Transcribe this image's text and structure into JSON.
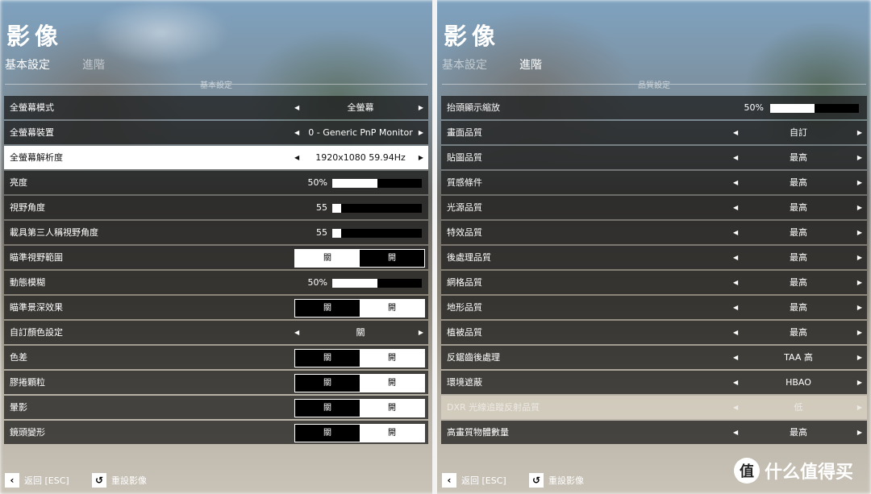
{
  "left": {
    "title": "影像",
    "tabs": [
      "基本設定",
      "進階"
    ],
    "section": "基本設定",
    "rows": [
      {
        "type": "select",
        "label": "全螢幕模式",
        "value": "全螢幕"
      },
      {
        "type": "select",
        "label": "全螢幕裝置",
        "value": "0 - Generic PnP Monitor"
      },
      {
        "type": "select",
        "label": "全螢幕解析度",
        "value": "1920x1080 59.94Hz",
        "selected": true
      },
      {
        "type": "slider",
        "label": "亮度",
        "value": "50%",
        "fraction": 0.5
      },
      {
        "type": "slider",
        "label": "視野角度",
        "value": "55",
        "fraction": 0.1
      },
      {
        "type": "slider",
        "label": "載具第三人稱視野角度",
        "value": "55",
        "fraction": 0.1
      },
      {
        "type": "toggle",
        "label": "瞄準視野範圍",
        "off": "關",
        "on": "開",
        "active": "off"
      },
      {
        "type": "slider",
        "label": "動態模糊",
        "value": "50%",
        "fraction": 0.5
      },
      {
        "type": "toggle",
        "label": "瞄準景深效果",
        "off": "關",
        "on": "開",
        "active": "on"
      },
      {
        "type": "select",
        "label": "自訂顏色設定",
        "value": "關"
      },
      {
        "type": "toggle",
        "label": "色差",
        "off": "關",
        "on": "開",
        "active": "on"
      },
      {
        "type": "toggle",
        "label": "膠捲顆粒",
        "off": "關",
        "on": "開",
        "active": "on"
      },
      {
        "type": "toggle",
        "label": "暈影",
        "off": "關",
        "on": "開",
        "active": "on"
      },
      {
        "type": "toggle",
        "label": "鏡頭變形",
        "off": "關",
        "on": "開",
        "active": "on"
      }
    ],
    "footer": {
      "back": "返回 [ESC]",
      "reset": "重設影像"
    }
  },
  "right": {
    "title": "影像",
    "tabs": [
      "基本設定",
      "進階"
    ],
    "section": "品質設定",
    "rows": [
      {
        "type": "slider",
        "label": "抬頭顯示縮放",
        "value": "50%",
        "fraction": 0.5
      },
      {
        "type": "select",
        "label": "畫面品質",
        "value": "自訂"
      },
      {
        "type": "select",
        "label": "貼圖品質",
        "value": "最高"
      },
      {
        "type": "select",
        "label": "質感條件",
        "value": "最高"
      },
      {
        "type": "select",
        "label": "光源品質",
        "value": "最高"
      },
      {
        "type": "select",
        "label": "特效品質",
        "value": "最高"
      },
      {
        "type": "select",
        "label": "後處理品質",
        "value": "最高"
      },
      {
        "type": "select",
        "label": "網格品質",
        "value": "最高"
      },
      {
        "type": "select",
        "label": "地形品質",
        "value": "最高"
      },
      {
        "type": "select",
        "label": "植被品質",
        "value": "最高"
      },
      {
        "type": "select",
        "label": "反鋸齒後處理",
        "value": "TAA 高"
      },
      {
        "type": "select",
        "label": "環境遮蔽",
        "value": "HBAO"
      },
      {
        "type": "select",
        "label": "DXR 光線追蹤反射品質",
        "value": "低",
        "disabled": true
      },
      {
        "type": "select",
        "label": "高畫質物體數量",
        "value": "最高"
      }
    ],
    "footer": {
      "back": "返回 [ESC]",
      "reset": "重設影像"
    }
  },
  "icons": {
    "back": "back-arrow-icon",
    "reset": "reset-icon",
    "left": "triangle-left-icon",
    "right": "triangle-right-icon"
  },
  "brand": {
    "logo_text": "值",
    "text": "什么值得买"
  }
}
